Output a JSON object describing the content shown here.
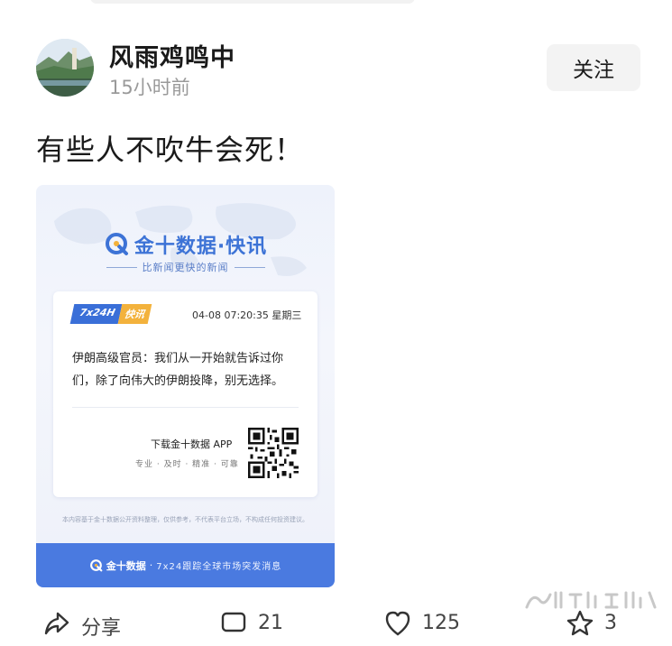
{
  "post": {
    "author_name": "风雨鸡鸣中",
    "time": "15小时前",
    "follow_label": "关注",
    "text": "有些人不吹牛会死！"
  },
  "card": {
    "brand_title": "金十数据·快讯",
    "brand_subtitle": "比新闻更快的新闻",
    "badge_left": "7x24H",
    "badge_right": "快讯",
    "date": "04-08 07:20:35 星期三",
    "body": "伊朗高级官员：我们从一开始就告诉过你们，除了向伟大的伊朗投降，别无选择。",
    "download_label": "下载金十数据 APP",
    "download_tags": "专业 · 及时 · 精准 · 可靠",
    "disclaimer": "本内容基于金十数据公开资料整理，仅供参考，不代表平台立场，不构成任何投资建议。",
    "footer_brand": "金十数据",
    "footer_sep": "·",
    "footer_text": "7x24跟踪全球市场突发消息",
    "accent_color": "#3d73d6",
    "badge_color": "#f3b23c"
  },
  "actions": {
    "share_label": "分享",
    "comment_count": "21",
    "like_count": "125",
    "favorite_count": "3"
  },
  "icons": [
    "share-icon",
    "comment-icon",
    "like-icon",
    "favorite-icon",
    "qr-code"
  ]
}
